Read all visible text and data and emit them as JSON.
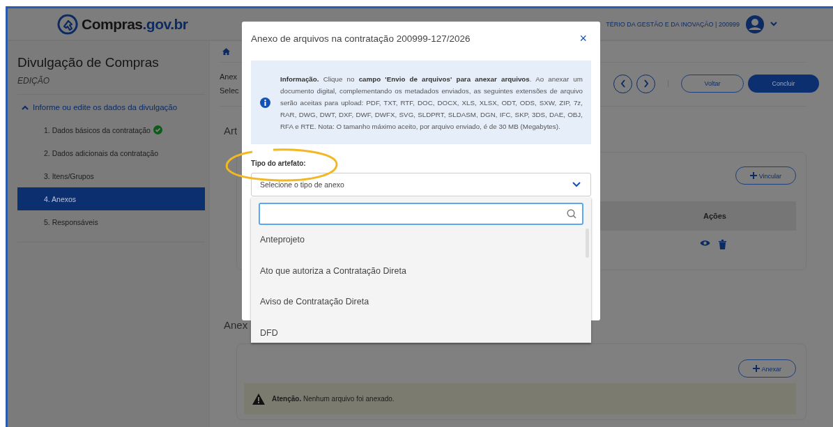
{
  "header": {
    "logo_main": "Compras",
    "logo_suffix": ".gov.br",
    "org": "TÉRIO DA GESTÃO E DA INOVAÇÃO | 200999"
  },
  "sidebar": {
    "title": "Divulgação de Compras",
    "subtitle": "EDIÇÃO",
    "section": {
      "label": "Informe ou edite os dados da divulgação",
      "expanded": true
    },
    "items": [
      {
        "label": "1. Dados básicos da contratação",
        "done": true,
        "selected": false
      },
      {
        "label": "2. Dados adicionais da contratação",
        "done": false,
        "selected": false
      },
      {
        "label": "3. Itens/Grupos",
        "done": false,
        "selected": false
      },
      {
        "label": "4. Anexos",
        "done": false,
        "selected": true
      },
      {
        "label": "5. Responsáveis",
        "done": false,
        "selected": false
      }
    ]
  },
  "main": {
    "heading_1": "Anex",
    "heading_2": "Selec",
    "buttons": [
      "Voltar",
      "Concluir"
    ],
    "section_1": "Art",
    "link_button": "Vincular",
    "actions_column": "Ações",
    "section_2": "Anex",
    "attach_button": "Anexar",
    "warning": "**Atenção.** Nenhum arquivo foi anexado."
  },
  "modal": {
    "title": "Anexo de arquivos na contratação 200999-127/2026",
    "close": "×",
    "info": "**Informação.** Clique no **campo 'Envio de arquivos' para anexar arquivos**. Ao anexar um documento digital, complementando os metadados enviados, as seguintes extensões de arquivo serão aceitas para upload: PDF, TXT, RTF, DOC, DOCX, XLS, XLSX, ODT, ODS, SXW, ZIP, 7z, RAR, DWG, DWT, DXF, DWF, DWFX, SVG, SLDPRT, SLDASM, DGN, IFC, SKP, 3DS, DAE, OBJ, RFA e RTE. Nota: O tamanho máximo aceito, por arquivo enviado, é de 30 MB (Megabytes).",
    "field_label": "Tipo do artefato:",
    "select_placeholder": "Selecione o tipo de anexo",
    "options": [
      "Anteprojeto",
      "Ato que autoriza a Contratação Direta",
      "Aviso de Contratação Direta",
      "DFD"
    ]
  }
}
